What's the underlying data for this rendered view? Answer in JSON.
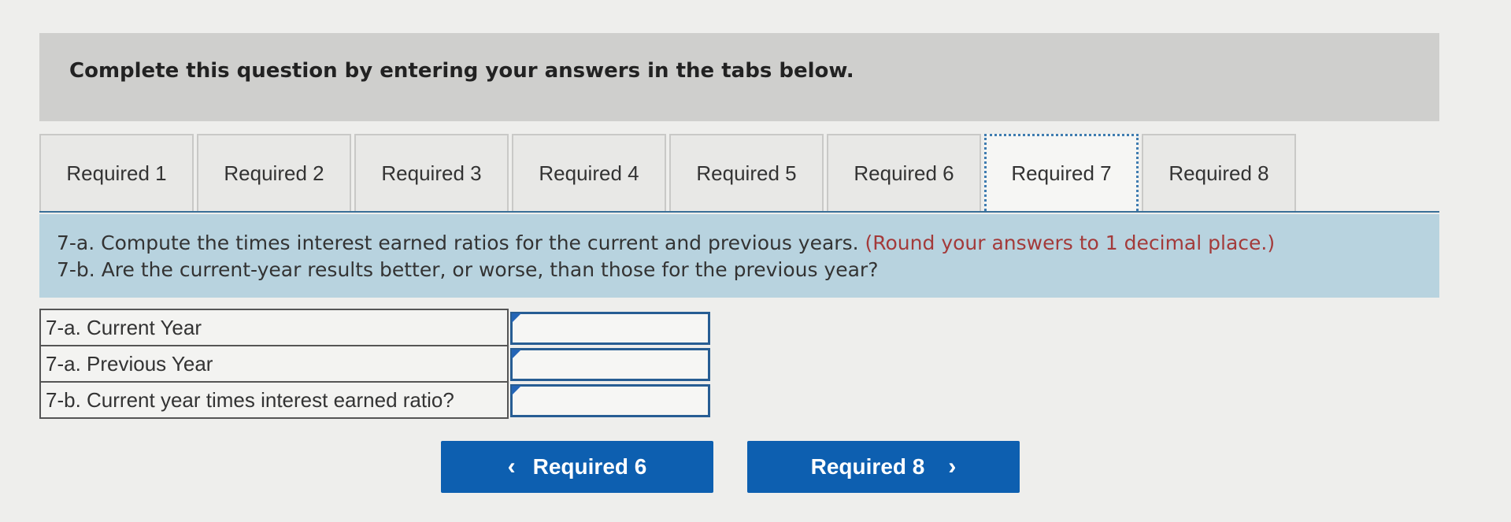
{
  "header": {
    "title": "Complete this question by entering your answers in the tabs below."
  },
  "tabs": [
    {
      "label": "Required 1",
      "active": false
    },
    {
      "label": "Required 2",
      "active": false
    },
    {
      "label": "Required 3",
      "active": false
    },
    {
      "label": "Required 4",
      "active": false
    },
    {
      "label": "Required 5",
      "active": false
    },
    {
      "label": "Required 6",
      "active": false
    },
    {
      "label": "Required 7",
      "active": true
    },
    {
      "label": "Required 8",
      "active": false
    }
  ],
  "instructions": {
    "line1_text": "7-a. Compute the times interest earned ratios for the current and previous years.",
    "line1_note": "(Round your answers to 1 decimal place.)",
    "line2_text": "7-b. Are the current-year results better, or worse, than those for the previous year?"
  },
  "answers": [
    {
      "label": "7-a. Current Year",
      "value": ""
    },
    {
      "label": "7-a. Previous Year",
      "value": ""
    },
    {
      "label": "7-b. Current year times interest earned ratio?",
      "value": ""
    }
  ],
  "navigation": {
    "prev_label": "Required 6",
    "next_label": "Required 8"
  },
  "colors": {
    "button_bg": "#0d5fb0",
    "instruction_bg": "#b8d3df",
    "note_text": "#a33a3a",
    "header_bg": "#cfcfcd"
  }
}
